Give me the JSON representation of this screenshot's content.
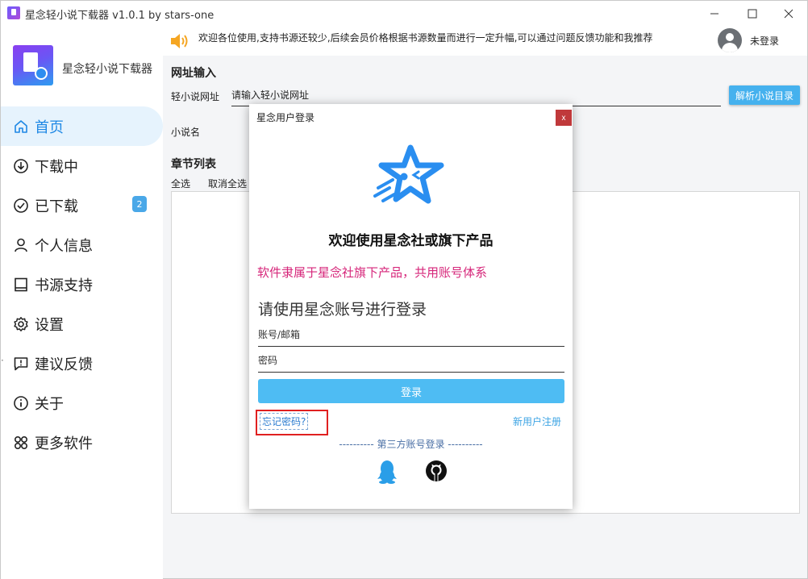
{
  "window": {
    "title": "星念轻小说下载器 v1.0.1 by stars-one"
  },
  "sidebar": {
    "app_name": "星念轻小说下载器",
    "items": [
      {
        "label": "首页",
        "icon": "home-icon",
        "active": true
      },
      {
        "label": "下载中",
        "icon": "download-circle-icon"
      },
      {
        "label": "已下载",
        "icon": "check-circle-icon",
        "badge": "2"
      },
      {
        "label": "个人信息",
        "icon": "user-icon"
      },
      {
        "label": "书源支持",
        "icon": "book-icon"
      },
      {
        "label": "设置",
        "icon": "gear-icon"
      },
      {
        "label": "建议反馈",
        "icon": "feedback-icon"
      },
      {
        "label": "关于",
        "icon": "info-icon"
      },
      {
        "label": "更多软件",
        "icon": "apps-icon"
      }
    ]
  },
  "header": {
    "notice": "欢迎各位使用,支持书源还较少,后续会员价格根据书源数量而进行一定升幅,可以通过问题反馈功能和我推荐",
    "login_status": "未登录"
  },
  "main": {
    "url_section_title": "网址输入",
    "url_label": "轻小说网址",
    "url_placeholder": "请输入轻小说网址",
    "parse_button": "解析小说目录",
    "novel_name_label": "小说名",
    "chapter_section_title": "章节列表",
    "select_all": "全选",
    "deselect_all": "取消全选"
  },
  "dialog": {
    "title": "星念用户登录",
    "close_label": "x",
    "welcome": "欢迎使用星念社或旗下产品",
    "subtitle": "软件隶属于星念社旗下产品，共用账号体系",
    "login_hint": "请使用星念账号进行登录",
    "account_placeholder": "账号/邮箱",
    "password_placeholder": "密码",
    "login_button": "登录",
    "forgot_password": "忘记密码?",
    "register": "新用户注册",
    "third_party": "---------- 第三方账号登录 ----------"
  },
  "colors": {
    "accent": "#45b1ee",
    "active_nav_bg": "#e6f3fd",
    "subtitle_pink": "#d6267a",
    "close_red": "#c0393b",
    "highlight_red": "#e02020"
  }
}
